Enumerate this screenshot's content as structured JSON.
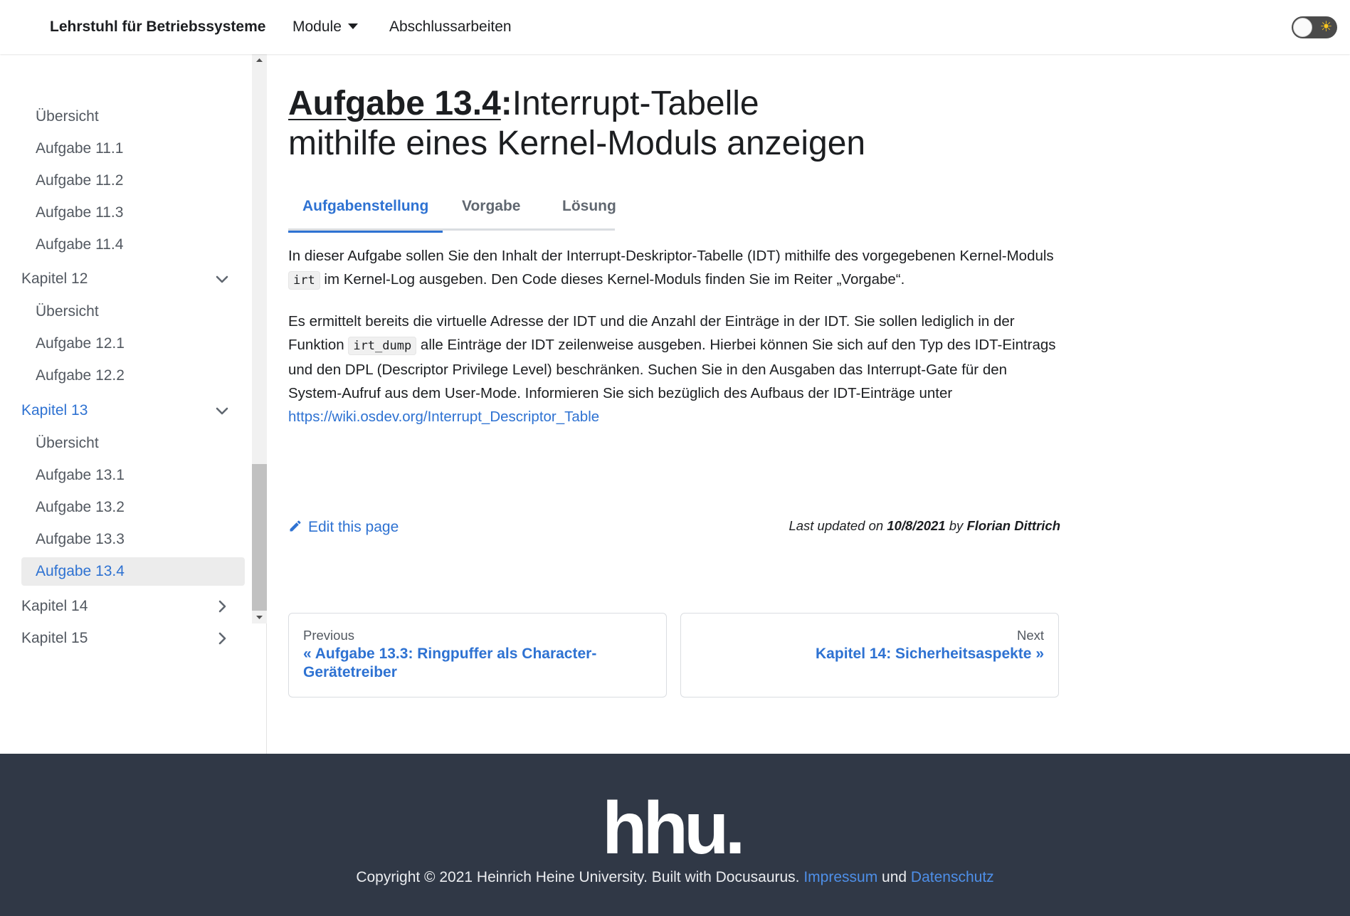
{
  "navbar": {
    "brand": "Lehrstuhl für Betriebssysteme",
    "modules": "Module",
    "theses": "Abschlussarbeiten",
    "theme_icon": "sun-icon"
  },
  "sidebar": {
    "items": [
      {
        "label": "Übersicht",
        "kind": "sub"
      },
      {
        "label": "Aufgabe 11.1",
        "kind": "sub"
      },
      {
        "label": "Aufgabe 11.2",
        "kind": "sub"
      },
      {
        "label": "Aufgabe 11.3",
        "kind": "sub"
      },
      {
        "label": "Aufgabe 11.4",
        "kind": "sub"
      },
      {
        "label": "Kapitel 12",
        "kind": "category",
        "state": "expanded"
      },
      {
        "label": "Übersicht",
        "kind": "sub"
      },
      {
        "label": "Aufgabe 12.1",
        "kind": "sub"
      },
      {
        "label": "Aufgabe 12.2",
        "kind": "sub"
      },
      {
        "label": "Kapitel 13",
        "kind": "category",
        "state": "expanded",
        "active": true
      },
      {
        "label": "Übersicht",
        "kind": "sub"
      },
      {
        "label": "Aufgabe 13.1",
        "kind": "sub"
      },
      {
        "label": "Aufgabe 13.2",
        "kind": "sub"
      },
      {
        "label": "Aufgabe 13.3",
        "kind": "sub"
      },
      {
        "label": "Aufgabe 13.4",
        "kind": "sub",
        "active": true
      },
      {
        "label": "Kapitel 14",
        "kind": "category",
        "state": "collapsed"
      },
      {
        "label": "Kapitel 15",
        "kind": "category",
        "state": "collapsed"
      }
    ]
  },
  "main": {
    "title_strong": "Aufgabe 13.4",
    "title_colon": ":",
    "title_rest1": "Interrupt-Tabelle",
    "title_rest2": "mithilfe eines Kernel-Moduls anzeigen",
    "tabs": [
      {
        "label": "Aufgabenstellung",
        "active": true
      },
      {
        "label": "Vorgabe"
      },
      {
        "label": "Lösung"
      }
    ],
    "para1": {
      "a": "In dieser Aufgabe sollen Sie den Inhalt der Interrupt-Deskriptor-Tabelle (IDT) mithilfe des vorgegebenen Kernel-Moduls ",
      "code": "irt",
      "b": " im Kernel-Log ausgeben. Den Code dieses Kernel-Moduls finden Sie im Reiter „Vorgabe“."
    },
    "para2": {
      "a": "Es ermittelt bereits die virtuelle Adresse der IDT und die Anzahl der Einträge in der IDT. Sie sollen lediglich in der Funktion ",
      "code": "irt_dump",
      "b": " alle Einträge der IDT zeilenweise ausgeben. Hierbei können Sie sich auf den Typ des IDT-Eintrags und den DPL (Descriptor Privilege Level) beschränken. Suchen Sie in den Ausgaben das Interrupt-Gate für den System-Aufruf aus dem User-Mode. Informieren Sie sich bezüglich des Aufbaus der IDT-Einträge unter ",
      "link": "https://wiki.osdev.org/Interrupt_Descriptor_Table"
    },
    "edit_label": "Edit this page",
    "updated_prefix": "Last updated on ",
    "updated_date": "10/8/2021",
    "updated_by": " by ",
    "updated_author": "Florian Dittrich",
    "prev": {
      "label": "Previous",
      "title": "« Aufgabe 13.3: Ringpuffer als Character-Gerätetreiber"
    },
    "next": {
      "label": "Next",
      "title": "Kapitel 14: Sicherheitsaspekte »"
    }
  },
  "footer": {
    "logo_text": "hhu.",
    "copyright": "Copyright © 2021 Heinrich Heine University. Built with Docusaurus. ",
    "impressum": "Impressum",
    "und": " und ",
    "datenschutz": "Datenschutz"
  },
  "colors": {
    "accent": "#2e72d2",
    "footer_bg": "#303846",
    "toggle_sun": "#f7c51f"
  }
}
